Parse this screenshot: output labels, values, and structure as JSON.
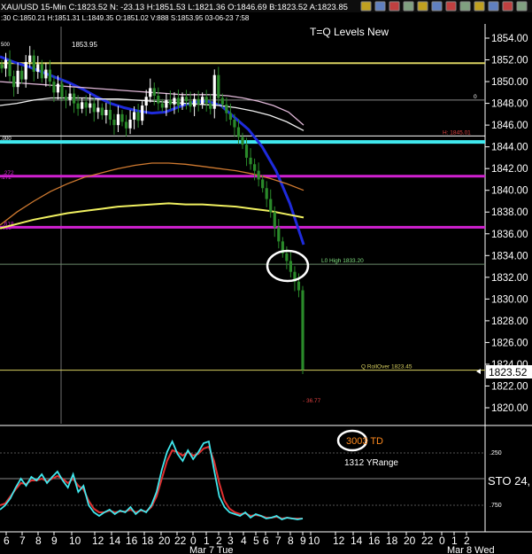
{
  "header": {
    "text": "XAU/USD 15-Min C:1823.52 N: -23.13 H:1851.53 L:1821.36 O:1846.69 B:1823.52 A:1823.85",
    "subtext": ":30 C:1850.21 H:1851.31 L:1849.35 O:1851.02 V:888 S:1853.95 03-06-23 7:58"
  },
  "toolbar_icons": [
    "lock-icon",
    "zoom-in-icon",
    "zoom-out-icon",
    "print-icon",
    "link-icon",
    "grid-icon",
    "settings-icon",
    "arrow-left-icon",
    "arrow-right-icon",
    "chart-icon",
    "reset-icon",
    "close-icon"
  ],
  "colors": {
    "background": "#000000",
    "candle_up": "#ffffff",
    "candle_down": "#2a8a2a",
    "ma_blue": "#1e2bdc",
    "ma_pink": "#e0b8d8",
    "ma_white": "#f0f0f0",
    "ma_orange": "#d07a30",
    "ma_yellow": "#f0f060",
    "level_cyan": "#40e8ee",
    "level_magenta": "#d020d0",
    "level_yellow": "#d8d060",
    "stoch_cyan": "#40e8ee",
    "stoch_red": "#e03030"
  },
  "chart_data": [
    {
      "type": "candlestick",
      "title": "T=Q Levels New",
      "ylim": [
        1818.5,
        1855.2
      ],
      "y_ticks": [
        "1854.00",
        "1852.00",
        "1850.00",
        "1848.00",
        "1846.00",
        "1844.00",
        "1842.00",
        "1840.00",
        "1838.00",
        "1836.00",
        "1834.00",
        "1832.00",
        "1830.00",
        "1828.00",
        "1826.00",
        "1824.00",
        "1822.00",
        "1820.00"
      ],
      "current_price": "1823.52",
      "top_value": "1853.95",
      "levels": [
        {
          "price": 1851.7,
          "color": "yellow",
          "label": ""
        },
        {
          "price": 1848.3,
          "color": "gray",
          "label": "0"
        },
        {
          "price": 1845.0,
          "color": "white",
          "label": "H: 1845.01"
        },
        {
          "price": 1844.45,
          "color": "cyan",
          "label": ""
        },
        {
          "price": 1841.3,
          "color": "magenta",
          "label": ".272"
        },
        {
          "price": 1836.6,
          "color": "magenta",
          "label": ".618"
        },
        {
          "price": 1833.2,
          "color": "green",
          "label": "L0 High 1833.20"
        },
        {
          "price": 1823.45,
          "color": "yellow",
          "label": "Q RollOver 1823.45"
        }
      ],
      "left_level_labels": [
        "500",
        "0",
        ".000",
        ".272",
        ".618"
      ],
      "annotations": [
        "- 36.77"
      ],
      "close_path": [
        1851.2,
        1852.0,
        1850.5,
        1849.5,
        1851.0,
        1850.2,
        1851.8,
        1852.4,
        1850.9,
        1851.6,
        1850.3,
        1851.1,
        1850.0,
        1849.0,
        1849.8,
        1848.6,
        1848.3,
        1848.9,
        1848.0,
        1847.5,
        1848.1,
        1847.6,
        1848.0,
        1847.2,
        1847.6,
        1846.9,
        1847.4,
        1846.5,
        1846.0,
        1847.0,
        1846.3,
        1845.7,
        1846.5,
        1847.2,
        1846.4,
        1847.8,
        1848.6,
        1849.4,
        1848.7,
        1848.0,
        1847.6,
        1848.3,
        1847.9,
        1848.5,
        1847.8,
        1848.6,
        1848.2,
        1847.7,
        1848.4,
        1847.9,
        1848.6,
        1848.0,
        1847.5,
        1850.6,
        1848.5,
        1847.9,
        1847.1,
        1846.5,
        1845.8,
        1844.9,
        1844.2,
        1843.0,
        1842.4,
        1841.8,
        1841.0,
        1840.2,
        1839.2,
        1838.0,
        1836.6,
        1835.3,
        1834.2,
        1833.5,
        1832.5,
        1831.6,
        1830.8,
        1823.5
      ],
      "moving_averages": [
        {
          "color": "blue",
          "values": [
            1852.3,
            1851.8,
            1851.4,
            1850.9,
            1850.4,
            1849.9,
            1849.3,
            1848.6,
            1848.0,
            1847.6,
            1847.3,
            1847.1,
            1847.2,
            1847.7,
            1848.1,
            1848.2,
            1847.8,
            1846.7,
            1845.6,
            1844.0,
            1841.8,
            1838.8,
            1835.0
          ]
        },
        {
          "color": "pink",
          "values": [
            1850.0,
            1849.9,
            1849.8,
            1849.7,
            1849.6,
            1849.5,
            1849.4,
            1849.3,
            1849.2,
            1849.1,
            1849.0,
            1848.9,
            1848.8,
            1848.8,
            1848.8,
            1848.7,
            1848.5,
            1848.2,
            1847.8,
            1847.2,
            1846.0
          ]
        },
        {
          "color": "white",
          "values": [
            1847.8,
            1848.0,
            1848.3,
            1848.5,
            1848.5,
            1848.5,
            1848.4,
            1848.4,
            1848.3,
            1848.2,
            1848.1,
            1848.0,
            1847.9,
            1847.8,
            1847.6,
            1847.3,
            1846.9,
            1846.3,
            1845.5
          ]
        },
        {
          "color": "orange",
          "values": [
            1836.8,
            1838.0,
            1839.0,
            1839.9,
            1840.6,
            1841.2,
            1841.6,
            1842.0,
            1842.3,
            1842.5,
            1842.5,
            1842.4,
            1842.2,
            1842.0,
            1841.8,
            1841.5,
            1841.1,
            1840.6,
            1840.0
          ]
        },
        {
          "color": "yellow",
          "values": [
            1836.5,
            1836.9,
            1837.3,
            1837.6,
            1837.9,
            1838.1,
            1838.3,
            1838.5,
            1838.6,
            1838.7,
            1838.8,
            1838.7,
            1838.7,
            1838.6,
            1838.5,
            1838.3,
            1838.1,
            1837.8,
            1837.5
          ]
        }
      ],
      "x_ticks": [
        "6",
        "7",
        "8",
        "9",
        "10",
        "12",
        "14",
        "16",
        "18",
        "20",
        "22",
        "0",
        "1",
        "2",
        "3",
        "4",
        "5",
        "6",
        "7",
        "8",
        "9",
        "10",
        "12",
        "14",
        "16",
        "18",
        "20",
        "22",
        "0",
        "1",
        "2"
      ],
      "date_labels": [
        "Mar 7 Tue",
        "Mar 8 Wed"
      ]
    },
    {
      "type": "line",
      "title": "STO 24,",
      "ylim": [
        0,
        100
      ],
      "y_ticks": [
        ".250",
        ".750"
      ],
      "text_labels": {
        "td": "3003 TD",
        "yrange": "1312 YRange"
      },
      "series": [
        {
          "color": "cyan",
          "values": [
            15,
            20,
            28,
            40,
            50,
            42,
            52,
            48,
            55,
            45,
            52,
            58,
            48,
            40,
            55,
            35,
            42,
            20,
            12,
            8,
            12,
            15,
            10,
            14,
            12,
            18,
            10,
            15,
            12,
            20,
            35,
            60,
            80,
            92,
            78,
            70,
            82,
            72,
            80,
            90,
            92,
            60,
            30,
            18,
            12,
            10,
            8,
            12,
            6,
            10,
            8,
            5,
            6,
            8,
            4,
            6,
            5,
            4,
            5
          ]
        },
        {
          "color": "red",
          "values": [
            20,
            22,
            30,
            38,
            45,
            44,
            48,
            48,
            50,
            47,
            50,
            53,
            50,
            45,
            50,
            42,
            38,
            25,
            16,
            12,
            12,
            14,
            12,
            13,
            13,
            15,
            12,
            14,
            13,
            18,
            30,
            50,
            70,
            82,
            80,
            76,
            80,
            76,
            78,
            84,
            86,
            70,
            45,
            25,
            16,
            12,
            10,
            11,
            8,
            9,
            8,
            6,
            6,
            7,
            5,
            6,
            5,
            5,
            5
          ]
        }
      ]
    }
  ]
}
